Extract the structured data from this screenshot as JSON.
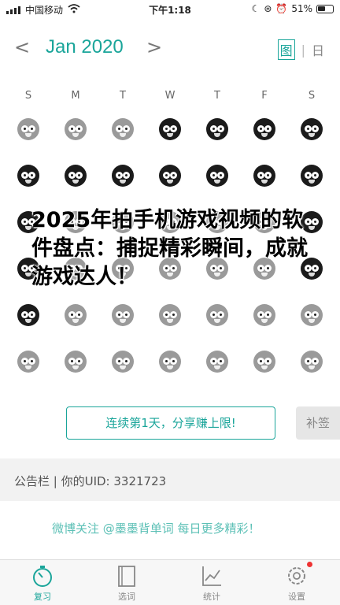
{
  "status_bar": {
    "carrier": "中国移动",
    "time": "下午1:18",
    "battery": "51%"
  },
  "calendar": {
    "month_label": "Jan 2020",
    "view_toggle": {
      "active": "图",
      "inactive": "日"
    },
    "weekdays": [
      "S",
      "M",
      "T",
      "W",
      "T",
      "F",
      "S"
    ],
    "rows": [
      [
        "grey",
        "grey",
        "grey",
        "dark",
        "dark",
        "dark",
        "dark"
      ],
      [
        "dark",
        "dark",
        "dark",
        "dark",
        "dark",
        "dark",
        "dark"
      ],
      [
        "dark",
        "grey",
        "grey",
        "grey",
        "grey",
        "grey",
        "dark"
      ],
      [
        "dark",
        "grey",
        "grey",
        "grey",
        "grey",
        "grey",
        "dark"
      ],
      [
        "dark",
        "grey",
        "grey",
        "grey",
        "grey",
        "grey",
        "grey"
      ],
      [
        "grey",
        "grey",
        "grey",
        "grey",
        "grey",
        "grey",
        "grey"
      ]
    ]
  },
  "headline": "2025年拍手机游戏视频的软件盘点：捕捉精彩瞬间，成就游戏达人！",
  "checkin": {
    "button_label": "连续第1天，分享赚上限!",
    "makeup_label": "补签"
  },
  "notice": {
    "label": "公告栏 | 你的UID: 3321723",
    "promo": "微博关注 @墨墨背单词 每日更多精彩！"
  },
  "tabbar": {
    "items": [
      {
        "label": "复习",
        "icon": "stopwatch-icon",
        "active": true
      },
      {
        "label": "选词",
        "icon": "book-icon",
        "active": false
      },
      {
        "label": "统计",
        "icon": "chart-icon",
        "active": false
      },
      {
        "label": "设置",
        "icon": "gear-icon",
        "active": false,
        "badge": true
      }
    ]
  },
  "colors": {
    "accent": "#1aa59a",
    "promo": "#5cc0b6",
    "badge": "#e33333"
  }
}
